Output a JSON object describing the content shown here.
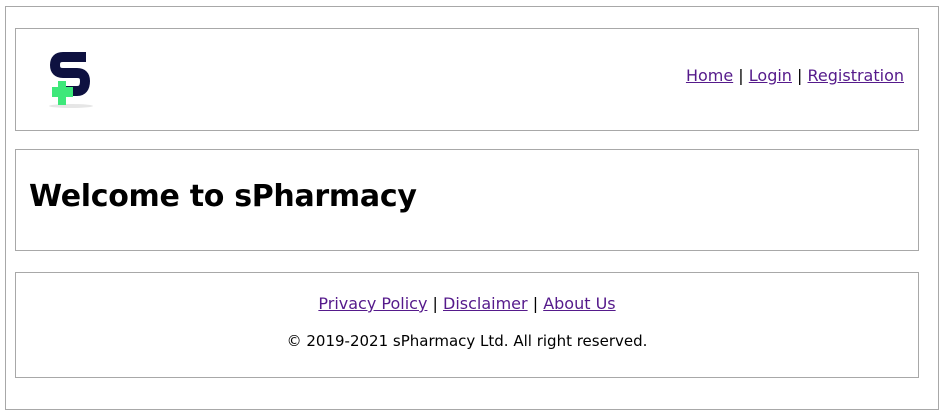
{
  "header": {
    "nav": {
      "home_label": "Home",
      "login_label": "Login",
      "registration_label": "Registration",
      "separator": "|"
    },
    "logo": {
      "icon": "spharmacy-logo-icon",
      "letter_color": "#0e1140",
      "cross_color": "#3ee87a"
    }
  },
  "main": {
    "welcome_text": "Welcome to sPharmacy"
  },
  "footer": {
    "links": {
      "privacy_label": "Privacy Policy",
      "disclaimer_label": "Disclaimer",
      "about_label": "About Us",
      "separator": "|"
    },
    "copyright": "© 2019-2021 sPharmacy Ltd. All right reserved."
  },
  "colors": {
    "link": "#551a8b",
    "border": "#a8a8a8",
    "text": "#000000"
  }
}
